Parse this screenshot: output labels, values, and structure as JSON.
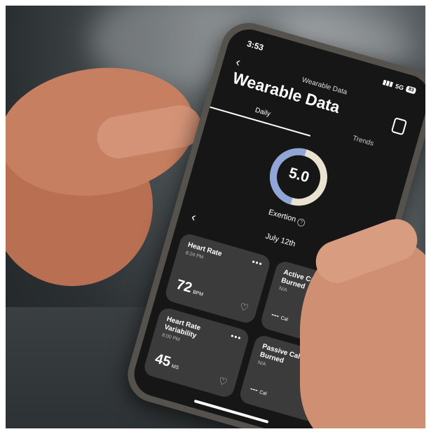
{
  "status": {
    "time": "3:53",
    "signal": "5G",
    "battery": "83"
  },
  "header": {
    "crumb": "Wearable Data",
    "title": "Wearable Data"
  },
  "tabs": [
    {
      "label": "Daily"
    },
    {
      "label": "Trends"
    }
  ],
  "gauge": {
    "value": "5.0",
    "label": "Exertion",
    "fill": 0.5
  },
  "date": "July 12th",
  "cards": [
    {
      "title": "Heart Rate",
      "sub": "8:24 PM",
      "value": "72",
      "unit": "BPM",
      "icon": "heart-icon"
    },
    {
      "title": "Active Calories Burned",
      "sub": "N/A",
      "value": "---",
      "unit": "Cal",
      "icon": "flame-icon"
    },
    {
      "title": "Heart Rate Variability",
      "sub": "6:00 PM",
      "value": "45",
      "unit": "MS",
      "icon": "heartbeat-icon"
    },
    {
      "title": "Passive Calories Burned",
      "sub": "N/A",
      "value": "---",
      "unit": "Cal",
      "icon": "flame-icon"
    }
  ],
  "colors": {
    "gauge_track": "#e9e2d0",
    "gauge_fill": "#8fa6d6",
    "card_bg": "#3b3b3b"
  }
}
